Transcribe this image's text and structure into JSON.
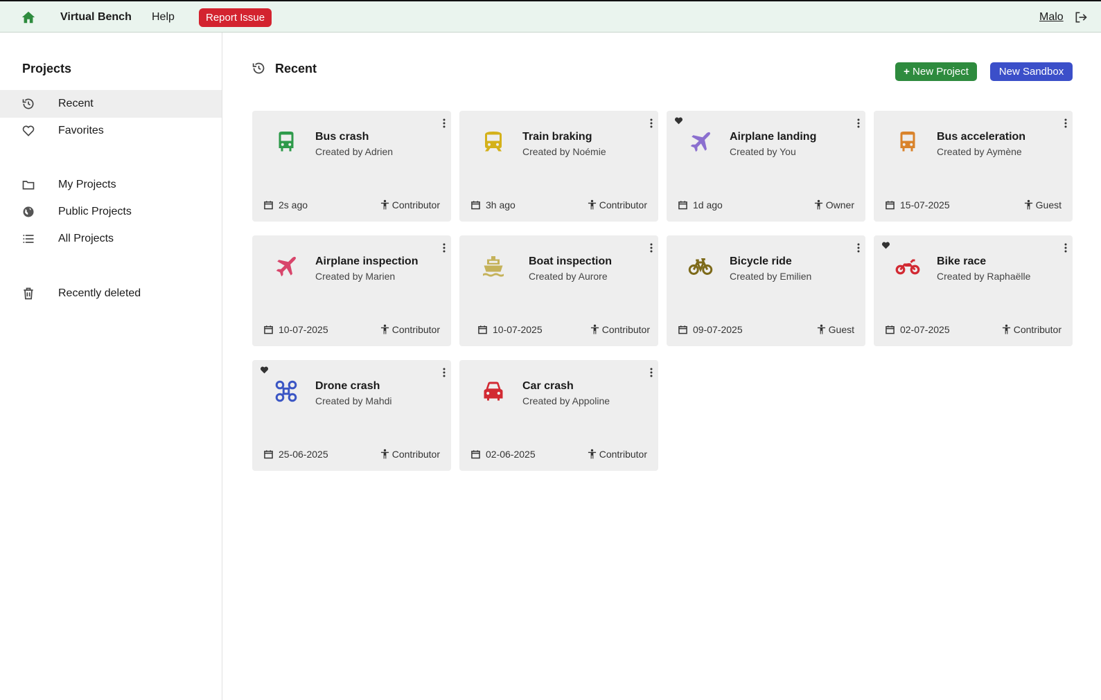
{
  "topbar": {
    "brand": "Virtual Bench",
    "help": "Help",
    "report_issue": "Report Issue",
    "user": "Malo"
  },
  "sidebar": {
    "title": "Projects",
    "items": [
      {
        "label": "Recent",
        "icon": "history-icon",
        "active": true
      },
      {
        "label": "Favorites",
        "icon": "heart-outline-icon"
      },
      {
        "label": "My Projects",
        "icon": "folder-icon"
      },
      {
        "label": "Public Projects",
        "icon": "globe-icon"
      },
      {
        "label": "All Projects",
        "icon": "list-icon"
      },
      {
        "label": "Recently deleted",
        "icon": "trash-icon"
      }
    ]
  },
  "main": {
    "title": "Recent",
    "new_project": "New Project",
    "new_sandbox": "New Sandbox"
  },
  "colors": {
    "bus-green": "#2e9a4a",
    "train-yellow": "#d4b11a",
    "airplane-purple": "#8b6fcf",
    "bus-orange": "#d9832b",
    "airplane-pink": "#d8456b",
    "boat-olive": "#c5b25a",
    "bicycle-olive": "#7d6a1a",
    "bike-red": "#d22a33",
    "drone-blue": "#3b56c4",
    "car-red": "#d22a33",
    "report": "#d3232f",
    "new-project": "#2e8b3e",
    "new-sandbox": "#3b4fc9"
  },
  "projects": [
    {
      "name": "Bus crash",
      "by": "Created by Adrien",
      "date": "2s ago",
      "role": "Contributor",
      "favorite": false,
      "icon": "bus-icon"
    },
    {
      "name": "Train braking",
      "by": "Created by Noémie",
      "date": "3h ago",
      "role": "Contributor",
      "favorite": false,
      "icon": "train-icon"
    },
    {
      "name": "Airplane landing",
      "by": "Created by You",
      "date": "1d ago",
      "role": "Owner",
      "favorite": true,
      "icon": "airplane-icon"
    },
    {
      "name": "Bus acceleration",
      "by": "Created by Aymène",
      "date": "15-07-2025",
      "role": "Guest",
      "favorite": false,
      "icon": "bus-icon"
    },
    {
      "name": "Airplane inspection",
      "by": "Created by Marien",
      "date": "10-07-2025",
      "role": "Contributor",
      "favorite": false,
      "icon": "airplane-icon"
    },
    {
      "name": "Boat inspection",
      "by": "Created by Aurore",
      "date": "10-07-2025",
      "role": "Contributor",
      "favorite": false,
      "icon": "boat-icon"
    },
    {
      "name": "Bicycle ride",
      "by": "Created by Emilien",
      "date": "09-07-2025",
      "role": "Guest",
      "favorite": false,
      "icon": "bicycle-icon"
    },
    {
      "name": "Bike race",
      "by": "Created by Raphaëlle",
      "date": "02-07-2025",
      "role": "Contributor",
      "favorite": true,
      "icon": "motorbike-icon"
    },
    {
      "name": "Drone crash",
      "by": "Created by Mahdi",
      "date": "25-06-2025",
      "role": "Contributor",
      "favorite": true,
      "icon": "drone-icon"
    },
    {
      "name": "Car crash",
      "by": "Created by Appoline",
      "date": "02-06-2025",
      "role": "Contributor",
      "favorite": false,
      "icon": "car-icon"
    }
  ]
}
